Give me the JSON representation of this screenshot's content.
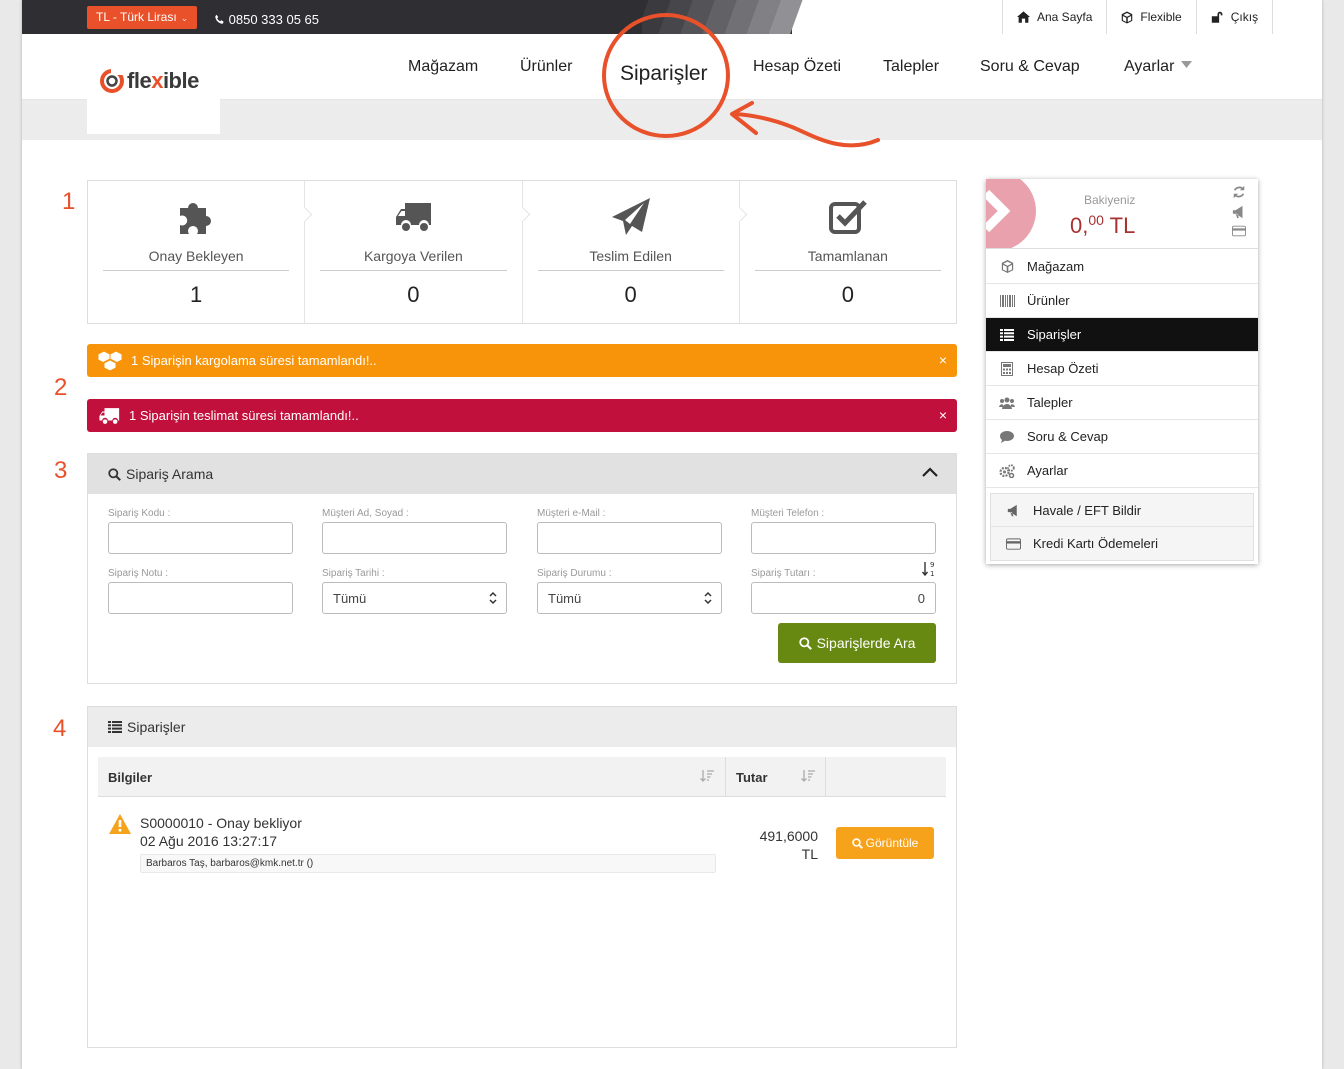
{
  "topbar": {
    "currency": "TL - Türk Lirası",
    "phone": "0850 333 05 65",
    "links": [
      {
        "label": "Ana Sayfa",
        "icon": "home-icon"
      },
      {
        "label": "Flexible",
        "icon": "cube-icon"
      },
      {
        "label": "Çıkış",
        "icon": "unlock-icon"
      }
    ]
  },
  "logo": {
    "text_a": "fle",
    "text_x": "x",
    "text_b": "ible"
  },
  "nav": {
    "items": [
      "Mağazam",
      "Ürünler",
      "Siparişler",
      "Hesap Özeti",
      "Talepler",
      "Soru & Cevap",
      "Ayarlar"
    ],
    "active": "Siparişler",
    "accent": "#e8512a"
  },
  "steps": [
    "1",
    "2",
    "3",
    "4"
  ],
  "stats": [
    {
      "label": "Onay Bekleyen",
      "value": "1",
      "icon": "puzzle-icon"
    },
    {
      "label": "Kargoya Verilen",
      "value": "0",
      "icon": "truck-icon"
    },
    {
      "label": "Teslim Edilen",
      "value": "0",
      "icon": "paper-plane-icon"
    },
    {
      "label": "Tamamlanan",
      "value": "0",
      "icon": "check-square-icon"
    }
  ],
  "alerts": [
    {
      "text": "1 Siparişin kargolama süresi tamamlandı!..",
      "color": "#f7940a",
      "icon": "cubes-icon",
      "close": "×"
    },
    {
      "text": "1 Siparişin teslimat süresi tamamlandı!..",
      "color": "#c2103d",
      "icon": "truck-icon",
      "close": "×"
    }
  ],
  "search": {
    "title": "Sipariş Arama",
    "fields": {
      "code": {
        "label": "Sipariş Kodu :",
        "value": ""
      },
      "name": {
        "label": "Müşteri Ad, Soyad :",
        "value": ""
      },
      "email": {
        "label": "Müşteri e-Mail :",
        "value": ""
      },
      "phone": {
        "label": "Müşteri Telefon :",
        "value": ""
      },
      "note": {
        "label": "Sipariş Notu :",
        "value": ""
      },
      "date": {
        "label": "Sipariş Tarihi :",
        "value": "Tümü"
      },
      "status": {
        "label": "Sipariş Durumu :",
        "value": "Tümü"
      },
      "amount": {
        "label": "Sipariş Tutarı :",
        "value": "0"
      }
    },
    "button": "Siparişlerde Ara",
    "button_color": "#678811"
  },
  "orders": {
    "title": "Siparişler",
    "columns": [
      "Bilgiler",
      "Tutar"
    ],
    "rows": [
      {
        "title": "S0000010 - Onay bekliyor",
        "date": "02 Ağu 2016 13:27:17",
        "customer": "Barbaros Taş, barbaros@kmk.net.tr ()",
        "amount": "491,6000",
        "currency": "TL",
        "action": "Görüntüle"
      }
    ]
  },
  "sidebar": {
    "balance_label": "Bakiyeniz",
    "balance_int": "0,",
    "balance_dec": "00",
    "balance_currency": "TL",
    "menu": [
      {
        "label": "Mağazam",
        "icon": "cube-icon"
      },
      {
        "label": "Ürünler",
        "icon": "barcode-icon"
      },
      {
        "label": "Siparişler",
        "icon": "list-icon",
        "active": true
      },
      {
        "label": "Hesap Özeti",
        "icon": "calculator-icon"
      },
      {
        "label": "Talepler",
        "icon": "users-icon"
      },
      {
        "label": "Soru & Cevap",
        "icon": "comment-icon"
      },
      {
        "label": "Ayarlar",
        "icon": "cogs-icon"
      }
    ],
    "submenu": [
      {
        "label": "Havale / EFT Bildir",
        "icon": "bullhorn-icon"
      },
      {
        "label": "Kredi Kartı Ödemeleri",
        "icon": "credit-card-icon"
      }
    ]
  }
}
